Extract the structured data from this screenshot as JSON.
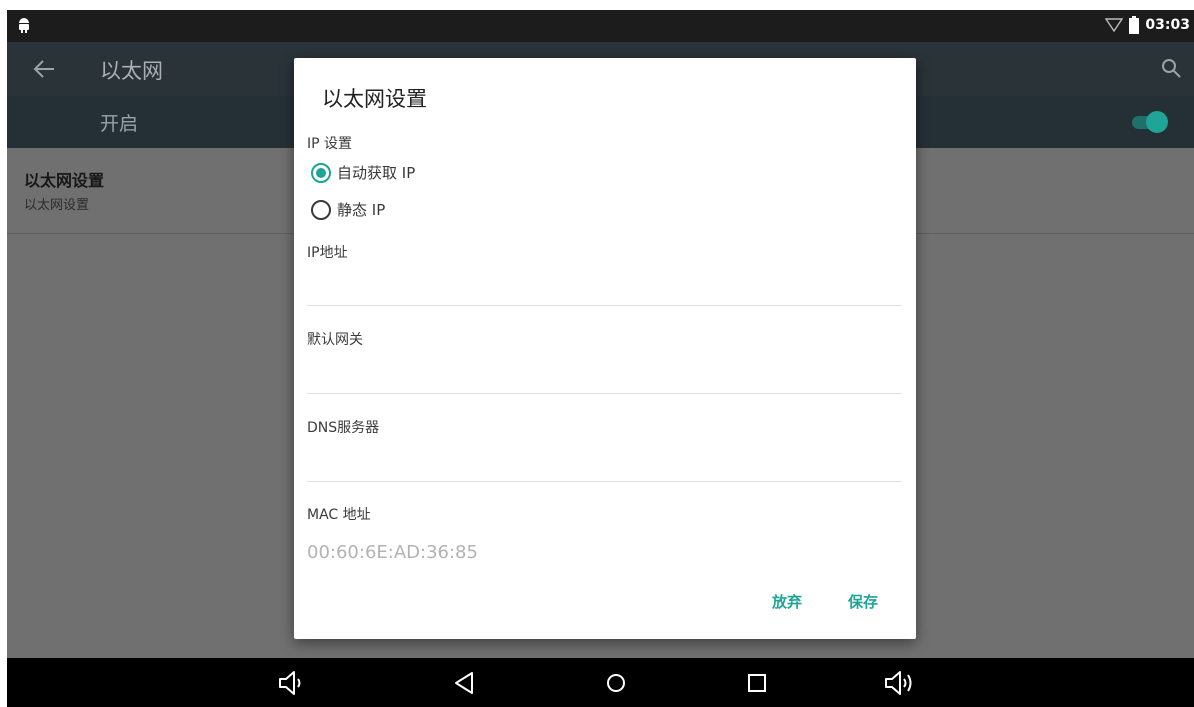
{
  "statusbar": {
    "time": "03:03",
    "icons": [
      "android-icon",
      "wifi-icon",
      "battery-icon"
    ]
  },
  "appbar": {
    "title": "以太网",
    "back_icon": "back-arrow-icon",
    "search_icon": "search-icon"
  },
  "switchbar": {
    "label": "开启",
    "checked": true
  },
  "preference": {
    "title": "以太网设置",
    "summary": "以太网设置"
  },
  "dialog": {
    "title": "以太网设置",
    "ip_settings_label": "IP 设置",
    "options": [
      {
        "label": "自动获取 IP",
        "selected": true
      },
      {
        "label": "静态 IP",
        "selected": false
      }
    ],
    "fields": [
      {
        "label": "IP地址",
        "value": ""
      },
      {
        "label": "默认网关",
        "value": ""
      },
      {
        "label": "DNS服务器",
        "value": ""
      },
      {
        "label": "MAC 地址",
        "value": "00:60:6E:AD:36:85"
      }
    ],
    "buttons": {
      "cancel": "放弃",
      "save": "保存"
    }
  },
  "navbar": {
    "icons": [
      "volume-down-icon",
      "back-icon",
      "home-icon",
      "recents-icon",
      "volume-up-icon"
    ]
  },
  "colors": {
    "accent": "#1fa497",
    "appbar": "#2a3338",
    "switchbar": "#253036",
    "scrim": "#707070"
  }
}
